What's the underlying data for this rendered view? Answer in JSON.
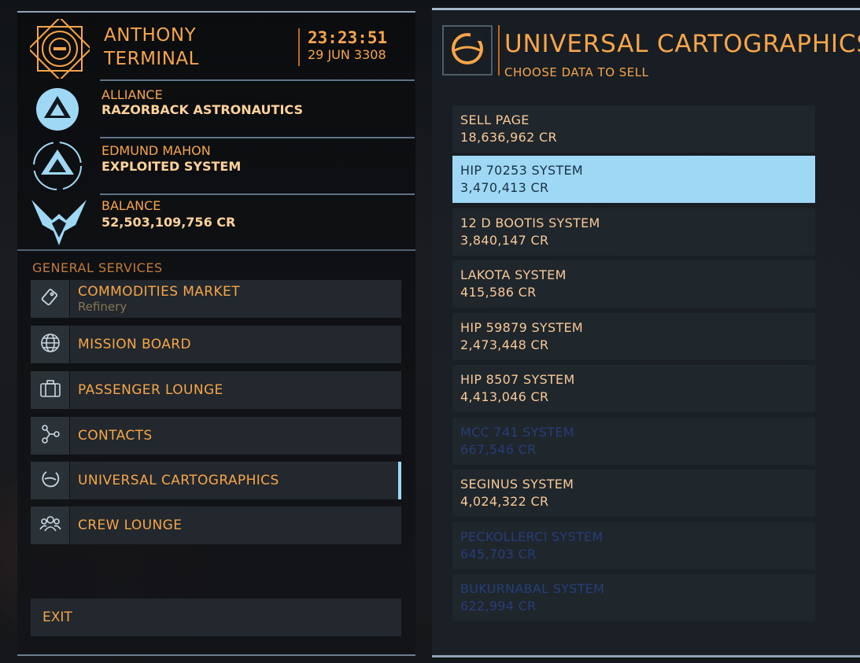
{
  "header": {
    "commander_line1": "ANTHONY",
    "commander_line2": "TERMINAL",
    "time": "23:23:51",
    "date": "29 JUN 3308"
  },
  "info": [
    {
      "label": "ALLIANCE",
      "value": "RAZORBACK ASTRONAUTICS",
      "icon": "alliance-icon"
    },
    {
      "label": "EDMUND MAHON",
      "value": "EXPLOITED SYSTEM",
      "icon": "power-icon"
    },
    {
      "label": "BALANCE",
      "value": "52,503,109,756 CR",
      "icon": "rank-wings-icon"
    }
  ],
  "services": {
    "title": "GENERAL SERVICES",
    "items": [
      {
        "label": "COMMODITIES MARKET",
        "sub": "Refinery",
        "icon": "tag-icon"
      },
      {
        "label": "MISSION BOARD",
        "icon": "globe-icon"
      },
      {
        "label": "PASSENGER LOUNGE",
        "icon": "suitcase-icon"
      },
      {
        "label": "CONTACTS",
        "icon": "network-icon"
      },
      {
        "label": "UNIVERSAL CARTOGRAPHICS",
        "icon": "planet-icon",
        "active": true
      },
      {
        "label": "CREW LOUNGE",
        "icon": "crew-icon"
      }
    ],
    "exit": "EXIT"
  },
  "cartographics": {
    "title": "UNIVERSAL CARTOGRAPHICS",
    "subtitle": "CHOOSE DATA TO SELL",
    "rows": [
      {
        "name": "SELL PAGE",
        "value": "18,636,962 CR"
      },
      {
        "name": "HIP 70253 SYSTEM",
        "value": "3,470,413 CR",
        "selected": true
      },
      {
        "name": "12 D BOOTIS SYSTEM",
        "value": "3,840,147 CR"
      },
      {
        "name": "LAKOTA SYSTEM",
        "value": "415,586 CR"
      },
      {
        "name": "HIP 59879 SYSTEM",
        "value": "2,473,448 CR"
      },
      {
        "name": "HIP 8507 SYSTEM",
        "value": "4,413,046 CR"
      },
      {
        "name": "MCC 741 SYSTEM",
        "value": "667,546 CR",
        "dim": true
      },
      {
        "name": "SEGINUS SYSTEM",
        "value": "4,024,322 CR"
      },
      {
        "name": "PECKOLLERCI SYSTEM",
        "value": "645,703 CR",
        "dim": true
      },
      {
        "name": "BUKURNABAL SYSTEM",
        "value": "622,994 CR",
        "dim": true
      }
    ]
  },
  "colors": {
    "accent": "#f7a54a",
    "selection": "#9fd8f5",
    "dim_text": "#263e78"
  }
}
